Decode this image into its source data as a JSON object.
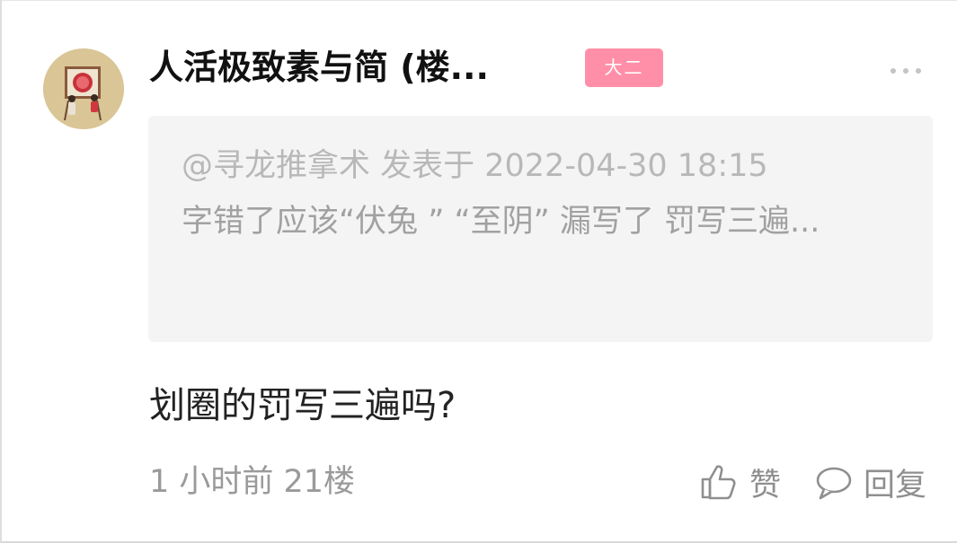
{
  "post": {
    "author": "人活极致素与简 (楼...",
    "badge": "大二",
    "more_icon": "more-dots-icon",
    "quote": {
      "header": "@寻龙推拿术 发表于 2022-04-30 18:15",
      "body": "字错了应该“伏兔 ” “至阴” 漏写了 罚写三遍..."
    },
    "content": "划圈的罚写三遍吗?",
    "meta": "1 小时前  21楼",
    "actions": {
      "like_label": "赞",
      "like_icon": "thumbs-up-icon",
      "reply_label": "回复",
      "reply_icon": "comment-bubble-icon"
    }
  },
  "colors": {
    "badge_bg": "#ff8fa8",
    "quote_bg": "#f4f4f4",
    "muted_text": "#9a9a9a"
  }
}
